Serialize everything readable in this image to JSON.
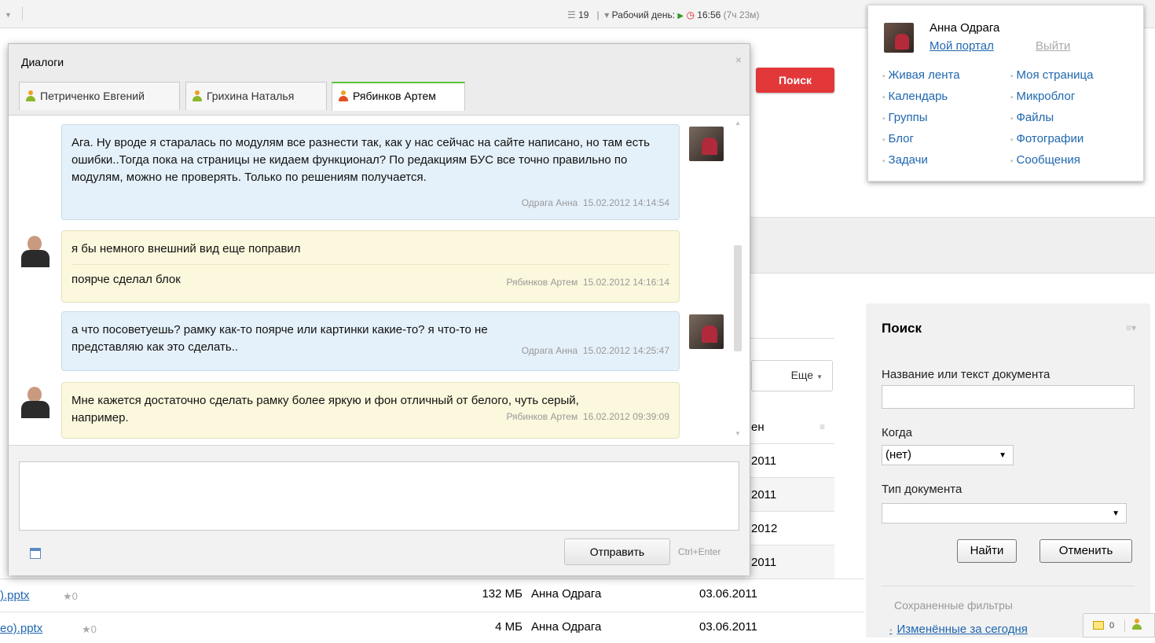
{
  "topbar": {
    "tasks_count": "19",
    "workday_label": "Рабочий день:",
    "time": "16:56",
    "duration": "(7ч 23м)"
  },
  "user_panel": {
    "name": "Анна Одрага",
    "my_portal": "Мой портал",
    "logout": "Выйти",
    "links_left": [
      "Живая лента",
      "Календарь",
      "Группы",
      "Блог",
      "Задачи"
    ],
    "links_right": [
      "Моя страница",
      "Микроблог",
      "Файлы",
      "Фотографии",
      "Сообщения"
    ]
  },
  "header_search_button": "Поиск",
  "more_button": "Еще",
  "table": {
    "header_partial": "ен",
    "dates_partial": [
      "2011",
      "2011",
      "2012",
      "2011"
    ],
    "rows": [
      {
        "file": ").pptx",
        "rating": "0",
        "size": "132 МБ",
        "owner": "Анна Одрага",
        "date": "03.06.2011"
      },
      {
        "file": "eo).pptx",
        "rating": "0",
        "size": "4 МБ",
        "owner": "Анна Одрага",
        "date": "03.06.2011"
      }
    ]
  },
  "search_panel": {
    "title": "Поиск",
    "name_label": "Название или текст документа",
    "name_value": "",
    "when_label": "Когда",
    "when_value": "(нет)",
    "type_label": "Тип документа",
    "type_value": "",
    "find_button": "Найти",
    "cancel_button": "Отменить",
    "saved_filters_label": "Сохраненные фильтры",
    "saved_filter_item": "Изменённые за сегодня"
  },
  "tray": {
    "notifications_count": "0"
  },
  "dialog": {
    "title": "Диалоги",
    "tabs": [
      "Петриченко Евгений",
      "Грихина Наталья",
      "Рябинков Артем"
    ],
    "active_tab": "Рябинков Артем",
    "messages": [
      {
        "author": "Одрага Анна",
        "time": "15.02.2012 14:14:54",
        "lines": [
          "Ага. Ну вроде я старалась по модулям все разнести так, как у нас сейчас на сайте написано, но там есть ошибки..Тогда пока на страницы не кидаем функционал? По редакциям БУС все точно правильно по модулям, можно не проверять. Только по решениям получается."
        ]
      },
      {
        "author": "Рябинков Артем",
        "time": "15.02.2012 14:16:14",
        "lines": [
          "я бы немного внешний вид еще поправил",
          "поярче сделал блок"
        ]
      },
      {
        "author": "Одрага Анна",
        "time": "15.02.2012 14:25:47",
        "lines": [
          "а что посоветуешь? рамку как-то поярче или картинки какие-то? я что-то не представляю как это сделать.."
        ]
      },
      {
        "author": "Рябинков Артем",
        "time": "16.02.2012 09:39:09",
        "lines": [
          "Мне кажется достаточно сделать рамку более яркую и фон отличный от белого, чуть серый, например."
        ]
      }
    ],
    "compose_value": "",
    "send_button": "Отправить",
    "send_hint": "Ctrl+Enter"
  }
}
